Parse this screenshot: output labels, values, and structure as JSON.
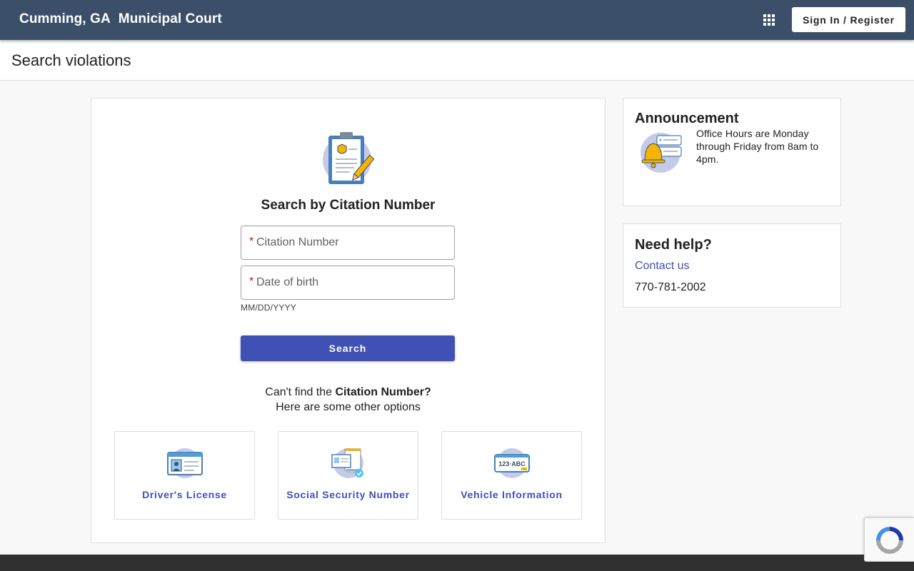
{
  "header": {
    "city": "Cumming, GA",
    "court": "Municipal Court",
    "apps_icon": "grid-icon",
    "signin_label": "Sign In / Register",
    "bg_color": "#3b5068"
  },
  "page": {
    "title": "Search violations"
  },
  "search": {
    "icon": "clipboard-badge-pencil-icon",
    "title": "Search by Citation Number",
    "citation_placeholder": "Citation Number",
    "dob_placeholder": "Date of birth",
    "required_mark": "*",
    "dob_hint": "MM/DD/YYYY",
    "button_label": "Search",
    "cant_find_prefix": "Can't find the ",
    "cant_find_bold": "Citation Number?",
    "other_options": "Here are some other options"
  },
  "options": [
    {
      "label": "Driver's License",
      "icon": "id-card-icon"
    },
    {
      "label": "Social Security Number",
      "icon": "ssn-document-icon"
    },
    {
      "label": "Vehicle Information",
      "icon": "license-plate-icon"
    }
  ],
  "announcement": {
    "title": "Announcement",
    "icon": "bell-icon",
    "text": "Office Hours are Monday through Friday from 8am to 4pm."
  },
  "help": {
    "title": "Need help?",
    "contact_label": "Contact us",
    "phone": "770-781-2002"
  },
  "colors": {
    "accent": "#3f51b5",
    "required": "#b71c1c",
    "footer": "#303030"
  }
}
